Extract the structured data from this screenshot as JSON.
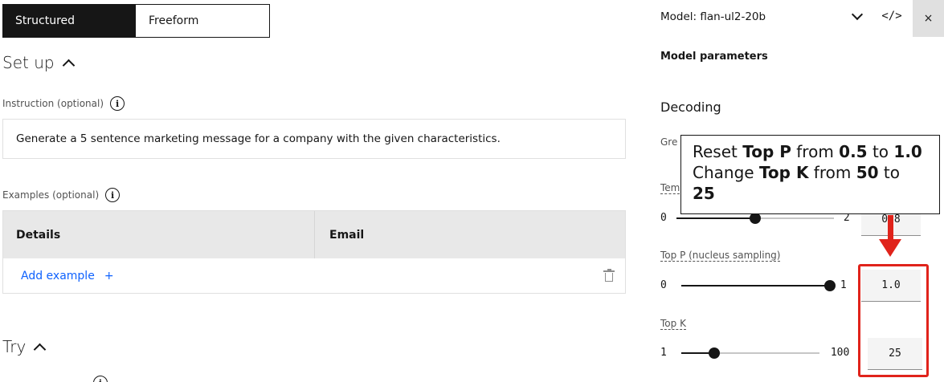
{
  "tabs": {
    "structured": "Structured",
    "freeform": "Freeform"
  },
  "setup": {
    "title": "Set up",
    "instruction_label": "Instruction (optional)",
    "instruction_text": "Generate a 5 sentence marketing message for a company with the given characteristics.",
    "examples_label": "Examples (optional)",
    "columns": [
      "Details",
      "Email"
    ],
    "add_example": "Add example",
    "add_icon": "+"
  },
  "try": {
    "title": "Try"
  },
  "panel": {
    "model_label": "Model: flan-ul2-20b",
    "code_icon": "</>",
    "close_icon": "×",
    "title": "Model parameters",
    "decoding": "Decoding",
    "greedy_partial": "Gre",
    "temperature": {
      "label_partial": "Tem",
      "min": "0",
      "max": "2",
      "value_partial": "0.8",
      "value_fraction": 0.5
    },
    "top_p": {
      "label": "Top P (nucleus sampling)",
      "min": "0",
      "max": "1",
      "value": "1.0",
      "value_fraction": 1.0
    },
    "top_k": {
      "label": "Top K",
      "min": "1",
      "max": "100",
      "value": "25",
      "value_fraction": 0.24
    }
  },
  "callout": {
    "line1_a": "Reset ",
    "line1_b": "Top P",
    "line1_c": " from ",
    "line1_d": "0.5",
    "line1_e": " to ",
    "line1_f": "1.0",
    "line2_a": "Change ",
    "line2_b": "Top K",
    "line2_c": " from ",
    "line2_d": "50",
    "line2_e": " to",
    "line3": "25"
  },
  "colors": {
    "annotation": "#e0231b",
    "link": "#0f62fe",
    "tab_active": "#161616"
  }
}
